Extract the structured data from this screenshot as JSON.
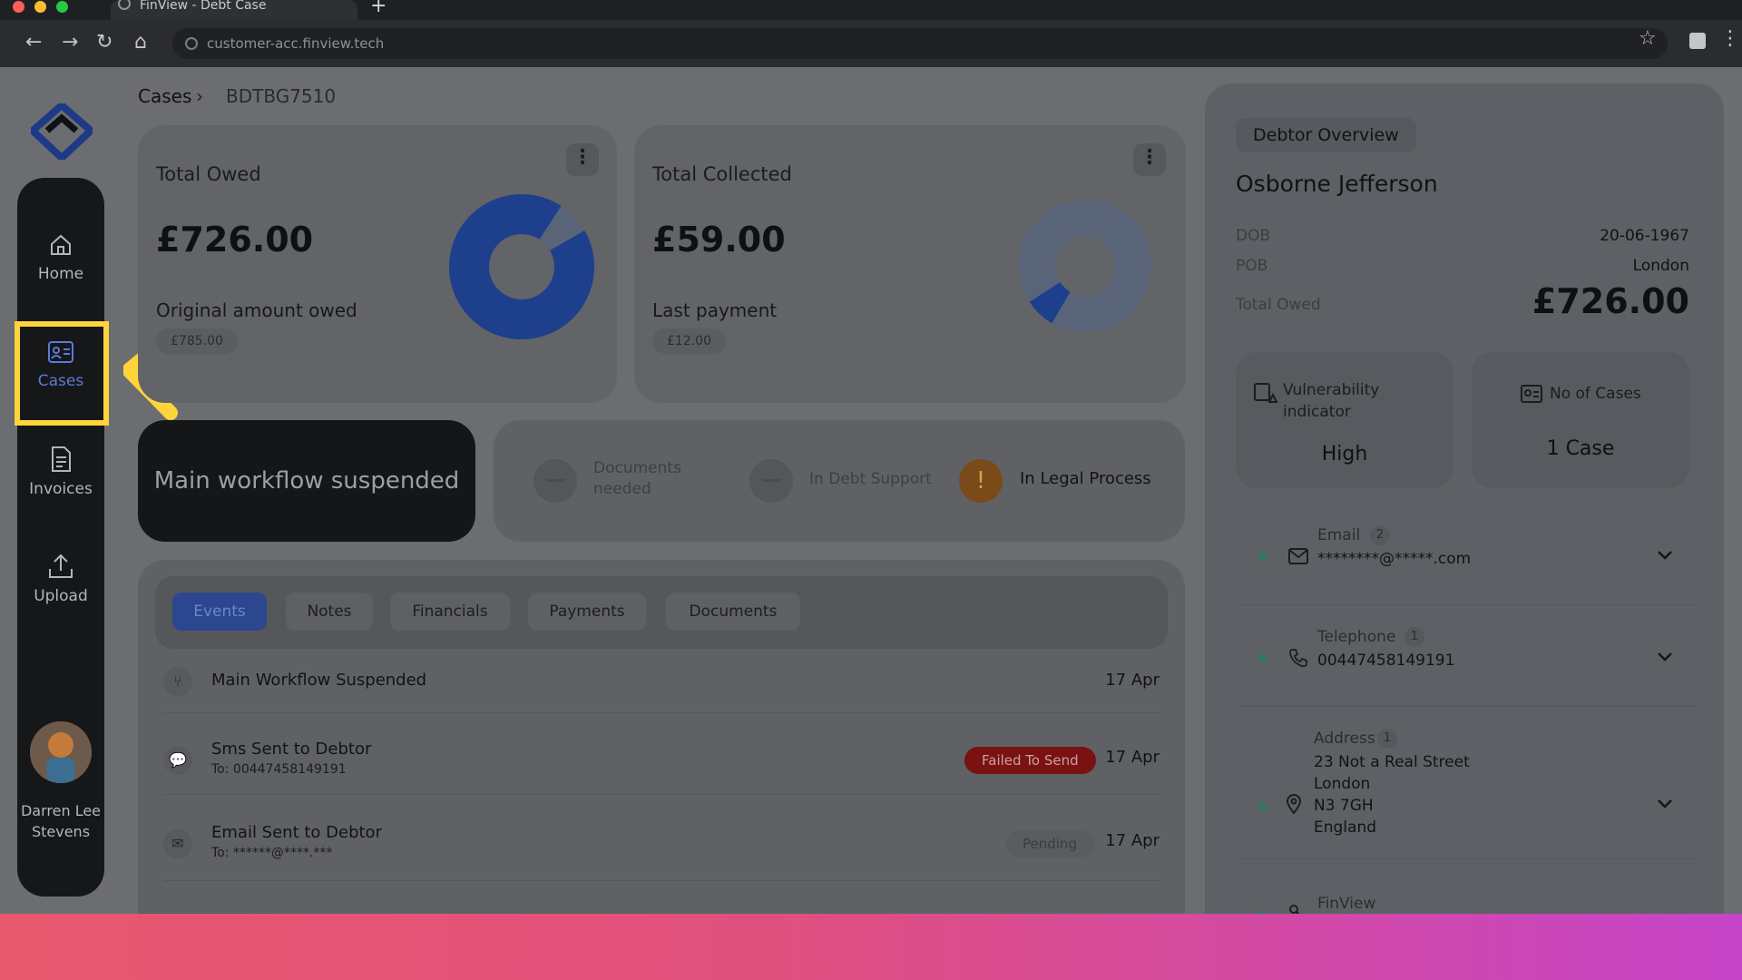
{
  "browser": {
    "tab_title": "FinView - Debt Case",
    "url": "customer-acc.finview.tech"
  },
  "sidebar": {
    "items": [
      {
        "label": "Home",
        "icon": "home-icon",
        "active": false
      },
      {
        "label": "Cases",
        "icon": "id-card-icon",
        "active": true
      },
      {
        "label": "Invoices",
        "icon": "document-icon",
        "active": false
      },
      {
        "label": "Upload",
        "icon": "upload-icon",
        "active": false
      }
    ],
    "user_name": "Darren Lee Stevens",
    "accent": "#5b7bd6"
  },
  "breadcrumb": {
    "root": "Cases",
    "current": "BDTBG7510"
  },
  "cards": {
    "owed": {
      "title": "Total Owed",
      "amount": "£726.00",
      "sub_label": "Original amount owed",
      "sub_value": "£785.00",
      "ring_fraction": 0.925
    },
    "collected": {
      "title": "Total Collected",
      "amount": "£59.00",
      "sub_label": "Last payment",
      "sub_value": "£12.00",
      "ring_fraction": 0.075
    }
  },
  "workflow": {
    "status": "Main workflow suspended",
    "steps": [
      {
        "label": "Documents needed",
        "active": false
      },
      {
        "label": "In Debt Support",
        "active": false
      },
      {
        "label": "In Legal Process",
        "active": true,
        "icon": "!"
      }
    ]
  },
  "events": {
    "tabs": [
      "Events",
      "Notes",
      "Financials",
      "Payments",
      "Documents"
    ],
    "active_tab": "Events",
    "rows": [
      {
        "icon": "branch-icon",
        "title": "Main Workflow Suspended",
        "subtitle": "",
        "badge": "",
        "badge_type": "",
        "date": "17 Apr"
      },
      {
        "icon": "chat-icon",
        "title": "Sms Sent to Debtor",
        "subtitle": "To: 00447458149191",
        "badge": "Failed To Send",
        "badge_type": "fail",
        "date": "17 Apr"
      },
      {
        "icon": "mail-icon",
        "title": "Email Sent to Debtor",
        "subtitle": "To: ******@****.***",
        "badge": "Pending",
        "badge_type": "pending",
        "date": "17 Apr"
      }
    ]
  },
  "debtor": {
    "chip": "Debtor Overview",
    "name": "Osborne Jefferson",
    "dob_label": "DOB",
    "dob": "20-06-1967",
    "pob_label": "POB",
    "pob": "London",
    "owed_label": "Total Owed",
    "owed": "£726.00",
    "vulnerability_label": "Vulnerability indicator",
    "vulnerability": "High",
    "cases_label": "No of Cases",
    "cases": "1 Case",
    "contacts": [
      {
        "label": "Email",
        "count": "2",
        "value": "********@*****.com",
        "icon": "mail-icon"
      },
      {
        "label": "Telephone",
        "count": "1",
        "value": "00447458149191",
        "icon": "phone-icon"
      },
      {
        "label": "Address",
        "count": "1",
        "lines": [
          "23 Not a Real Street",
          "London",
          "N3 7GH",
          "England"
        ],
        "icon": "location-pin-icon"
      },
      {
        "label": "FinView",
        "icon": "key-icon"
      }
    ]
  },
  "colors": {
    "highlight": "#ffd43b",
    "failed": "#7a1212",
    "legal": "#7a4b19"
  }
}
